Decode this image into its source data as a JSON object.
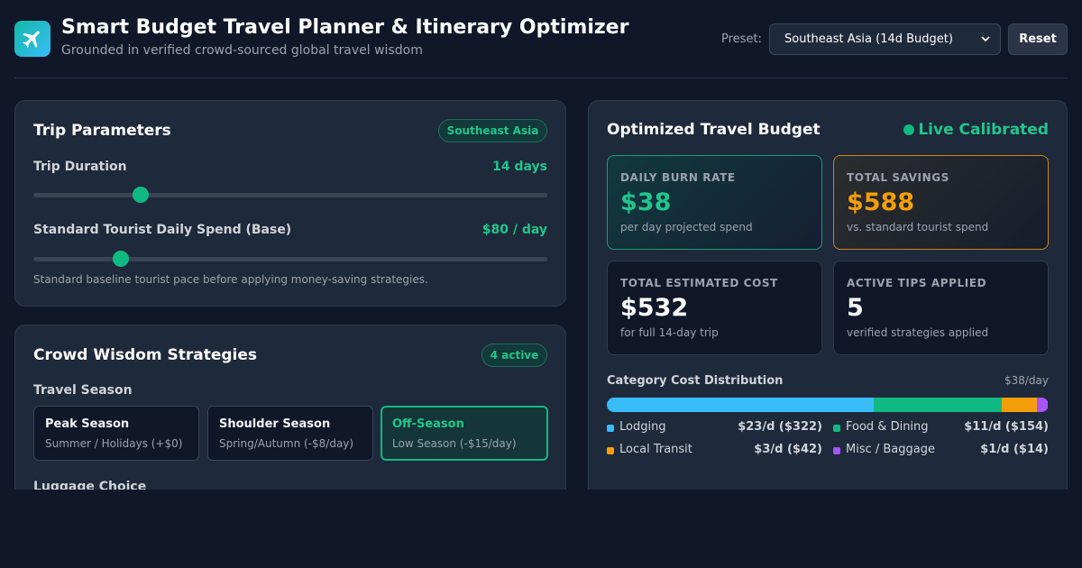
{
  "header": {
    "title": "Smart Budget Travel Planner & Itinerary Optimizer",
    "subtitle": "Grounded in verified crowd-sourced global travel wisdom",
    "preset_label": "Preset:",
    "preset_value": "Southeast Asia (14d Budget)",
    "reset_label": "Reset",
    "logo_icon": "airplane-icon"
  },
  "trip_parameters": {
    "title": "Trip Parameters",
    "region_badge": "Southeast Asia",
    "duration_label": "Trip Duration",
    "duration_value": "14 days",
    "duration_level": 0.2,
    "spend_label": "Standard Tourist Daily Spend (Base)",
    "spend_value": "$80 / day",
    "spend_level": 0.16,
    "spend_hint": "Standard baseline tourist pace before applying money-saving strategies."
  },
  "strategies": {
    "title": "Crowd Wisdom Strategies",
    "active_badge": "4 active",
    "season_heading": "Travel Season",
    "seasons": [
      {
        "title": "Peak Season",
        "sub": "Summer / Holidays (+$0)",
        "active": false
      },
      {
        "title": "Shoulder Season",
        "sub": "Spring/Autumn (-$8/day)",
        "active": false
      },
      {
        "title": "Off-Season",
        "sub": "Low Season (-$15/day)",
        "active": true
      }
    ],
    "luggage_heading": "Luggage Choice"
  },
  "budget": {
    "title": "Optimized Travel Budget",
    "live_label": "Live Calibrated",
    "stats": [
      {
        "key": "DAILY BURN RATE",
        "value": "$38",
        "desc": "per day projected spend"
      },
      {
        "key": "TOTAL SAVINGS",
        "value": "$588",
        "desc": "vs. standard tourist spend"
      },
      {
        "key": "TOTAL ESTIMATED COST",
        "value": "$532",
        "desc": "for full 14-day trip"
      },
      {
        "key": "ACTIVE TIPS APPLIED",
        "value": "5",
        "desc": "verified strategies applied"
      }
    ],
    "distribution_title": "Category Cost Distribution",
    "distribution_total": "$38/day",
    "categories": [
      {
        "name": "Lodging",
        "value": "$23/d ($322)",
        "share": 0.605,
        "color": "#38bdf8"
      },
      {
        "name": "Food & Dining",
        "value": "$11/d ($154)",
        "share": 0.289,
        "color": "#10b981"
      },
      {
        "name": "Local Transit",
        "value": "$3/d ($42)",
        "share": 0.079,
        "color": "#f59e0b"
      },
      {
        "name": "Misc / Baggage",
        "value": "$1/d ($14)",
        "share": 0.026,
        "color": "#a855f7"
      }
    ]
  }
}
